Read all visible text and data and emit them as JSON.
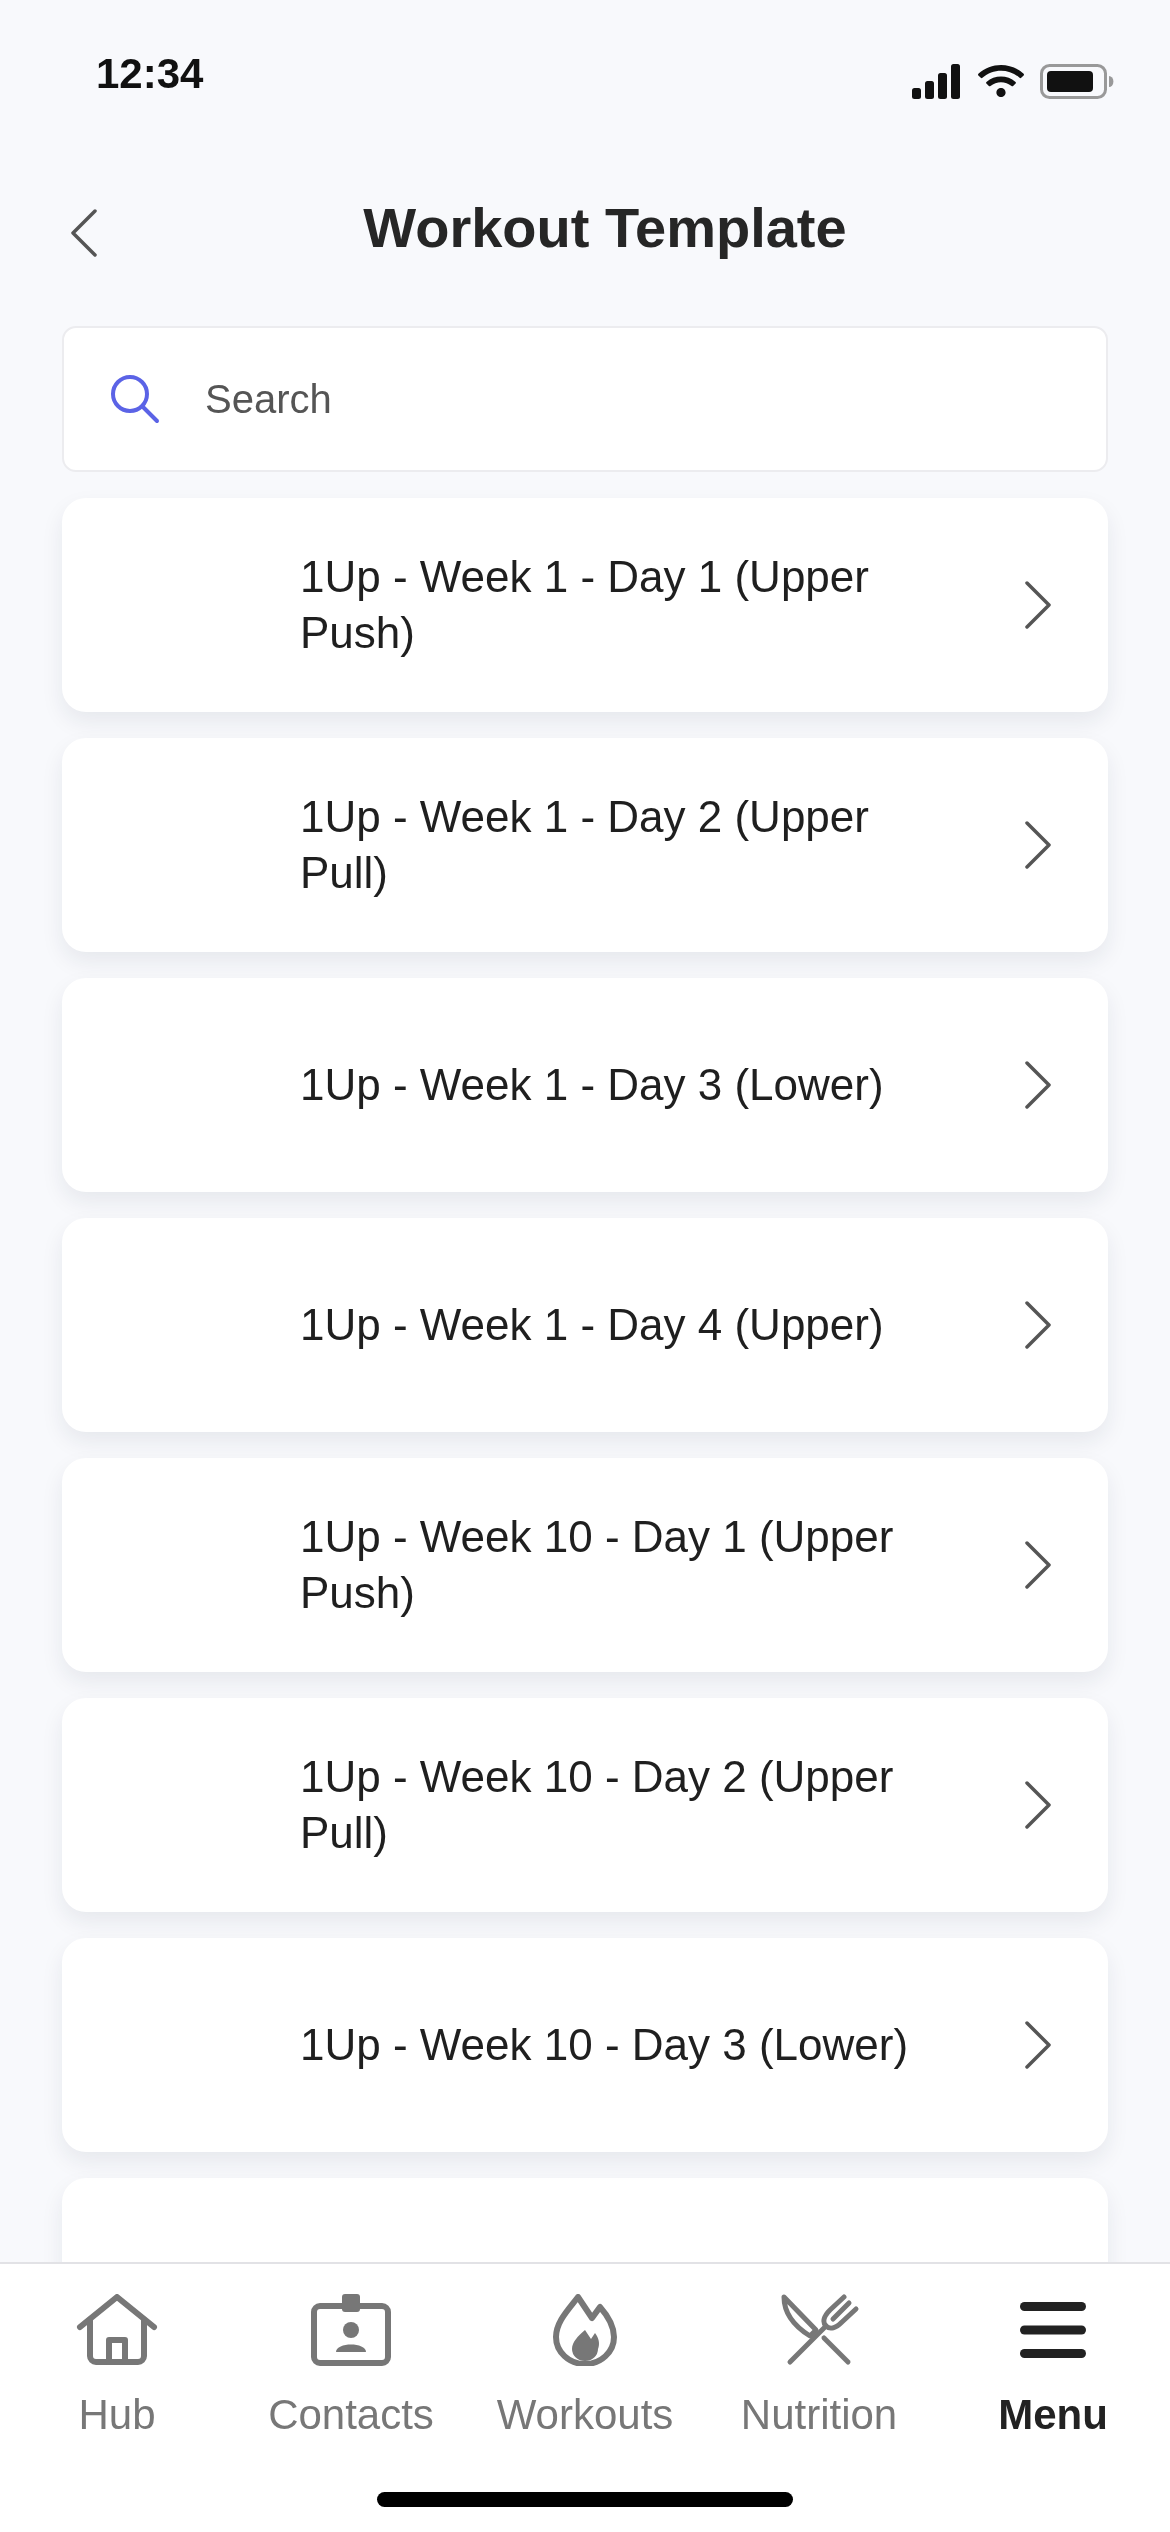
{
  "status_bar": {
    "time": "12:34"
  },
  "header": {
    "title": "Workout Template"
  },
  "search": {
    "placeholder": "Search"
  },
  "templates": [
    {
      "title": "1Up - Week 1 - Day 1 (Upper Push)"
    },
    {
      "title": "1Up - Week 1 - Day 2 (Upper Pull)"
    },
    {
      "title": "1Up - Week 1 - Day 3 (Lower)"
    },
    {
      "title": "1Up - Week 1 - Day 4 (Upper)"
    },
    {
      "title": "1Up - Week 10 - Day 1 (Upper Push)"
    },
    {
      "title": "1Up - Week 10 - Day 2 (Upper Pull)"
    },
    {
      "title": "1Up - Week 10 - Day 3 (Lower)"
    }
  ],
  "tab_bar": {
    "items": [
      {
        "label": "Hub",
        "selected": false
      },
      {
        "label": "Contacts",
        "selected": false
      },
      {
        "label": "Workouts",
        "selected": false
      },
      {
        "label": "Nutrition",
        "selected": false
      },
      {
        "label": "Menu",
        "selected": true
      }
    ]
  }
}
